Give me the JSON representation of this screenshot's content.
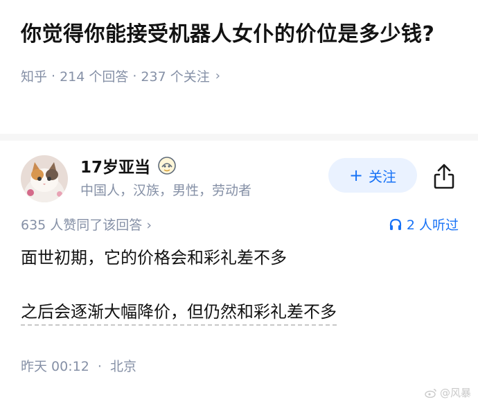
{
  "question": {
    "title": "你觉得你能接受机器人女仆的价位是多少钱?",
    "source": "知乎",
    "answers": "214 个回答",
    "followers": "237 个关注"
  },
  "author": {
    "name": "17岁亚当",
    "description": "中国人，汉族，男性，劳动者",
    "follow_label": "关注"
  },
  "stats": {
    "likes": "635 人赞同了该回答",
    "listeners": "2 人听过"
  },
  "answer": {
    "paragraphs": [
      "面世初期，它的价格会和彩礼差不多",
      "之后会逐渐大幅降价，但仍然和彩礼差不多"
    ],
    "time": "昨天 00:12",
    "location": "北京"
  },
  "watermark": "@风暴",
  "colors": {
    "accent": "#1772f6",
    "meta": "#8590a6",
    "follow_bg": "#eaf2ff"
  }
}
